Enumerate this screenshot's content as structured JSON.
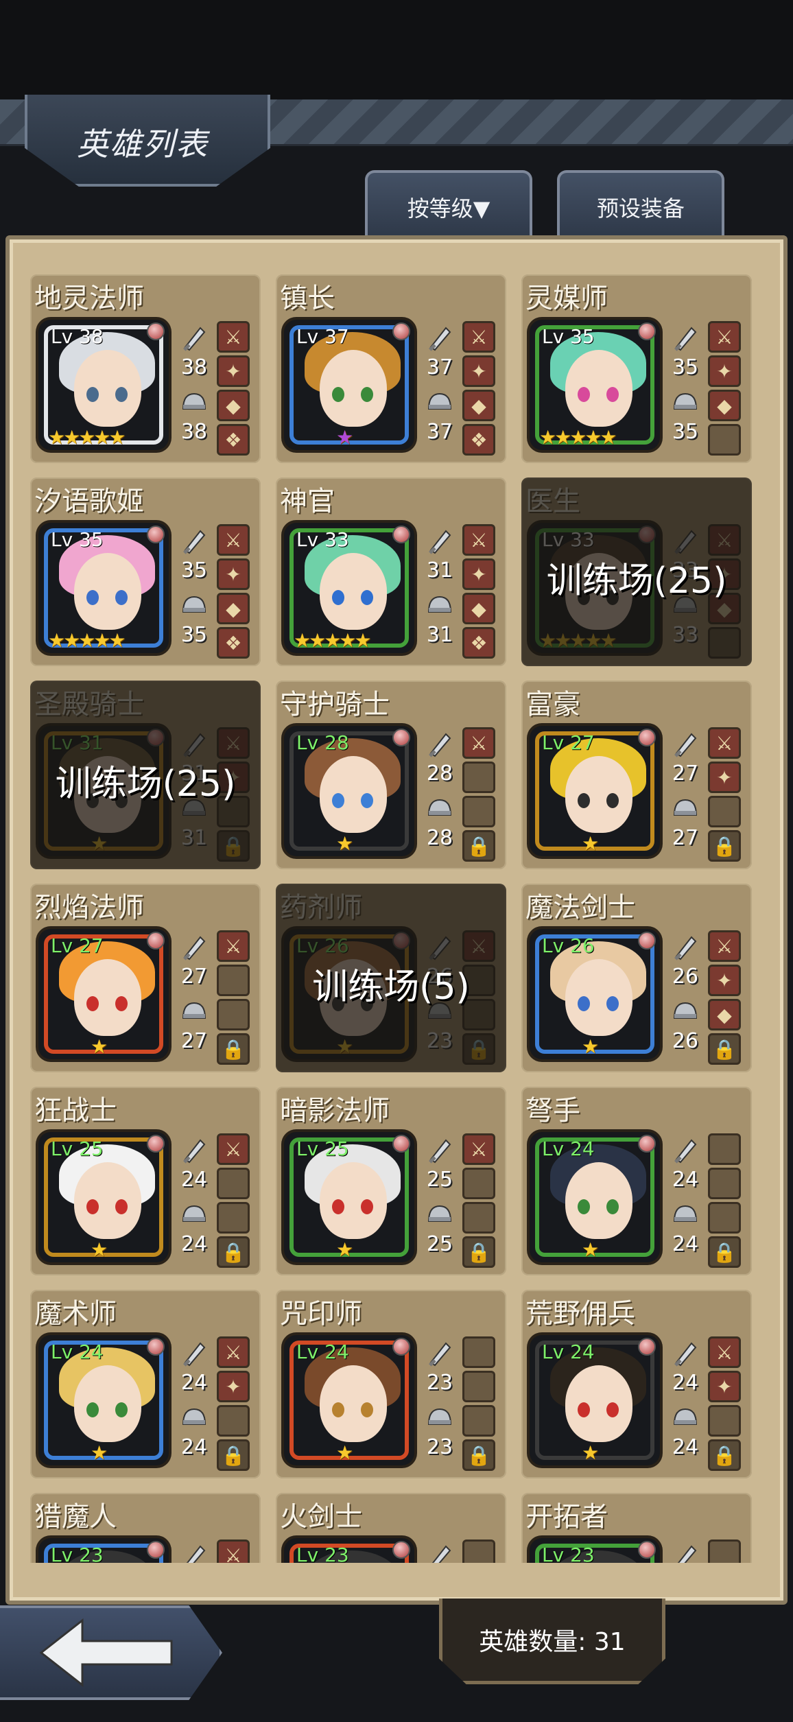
{
  "header": {
    "title": "英雄列表",
    "sort_button": "按等级▼",
    "preset_button": "预设装备"
  },
  "footer": {
    "hero_count": "英雄数量: 31"
  },
  "heroes": [
    {
      "name": "地灵法师",
      "level": "Lv 38",
      "atk": "38",
      "def": "38",
      "stars": 5,
      "color": "#e3e6ea",
      "hair": "#d9dde2",
      "eye": "#4a6b8d",
      "equip": [
        1,
        1,
        1,
        1
      ],
      "locked": false,
      "training": ""
    },
    {
      "name": "镇长",
      "level": "Lv 37",
      "atk": "37",
      "def": "37",
      "stars": 1,
      "color": "#3d7fd6",
      "hair": "#c7892f",
      "eye": "#3a8a3a",
      "equip": [
        1,
        1,
        1,
        1
      ],
      "locked": false,
      "training": ""
    },
    {
      "name": "灵媒师",
      "level": "Lv 35",
      "atk": "35",
      "def": "35",
      "stars": 5,
      "color": "#44a13a",
      "hair": "#6ad1b3",
      "eye": "#d84a9b",
      "equip": [
        1,
        1,
        1,
        0
      ],
      "locked": false,
      "training": ""
    },
    {
      "name": "汐语歌姬",
      "level": "Lv 35",
      "atk": "35",
      "def": "35",
      "stars": 5,
      "color": "#3d7fd6",
      "hair": "#f0a6cf",
      "eye": "#3c6fc9",
      "equip": [
        1,
        1,
        1,
        1
      ],
      "locked": false,
      "training": ""
    },
    {
      "name": "神官",
      "level": "Lv 33",
      "atk": "31",
      "def": "31",
      "stars": 5,
      "color": "#44a13a",
      "hair": "#6fd1a8",
      "eye": "#2f6fd0",
      "equip": [
        1,
        1,
        1,
        1
      ],
      "locked": false,
      "training": ""
    },
    {
      "name": "医生",
      "level": "Lv 33",
      "atk": "33",
      "def": "33",
      "stars": 5,
      "color": "#44a13a",
      "hair": "#4b3b2c",
      "eye": "#2d2d2d",
      "equip": [
        1,
        1,
        1,
        0
      ],
      "locked": false,
      "training": "训练场(25)"
    },
    {
      "name": "圣殿骑士",
      "level": "Lv 31",
      "atk": "31",
      "def": "31",
      "stars": 1,
      "color": "#c08a1e",
      "hair": "#6e5a3c",
      "eye": "#3a3a3a",
      "equip": [
        1,
        1,
        0,
        0
      ],
      "locked": true,
      "training": "训练场(25)"
    },
    {
      "name": "守护骑士",
      "level": "Lv 28",
      "atk": "28",
      "def": "28",
      "stars": 1,
      "color": "#3a3a3a",
      "hair": "#8c5a38",
      "eye": "#3d7fd6",
      "equip": [
        1,
        0,
        0,
        0
      ],
      "locked": true,
      "training": ""
    },
    {
      "name": "富豪",
      "level": "Lv 27",
      "atk": "27",
      "def": "27",
      "stars": 1,
      "color": "#c08a1e",
      "hair": "#e7c22b",
      "eye": "#2d2d2d",
      "equip": [
        1,
        1,
        0,
        0
      ],
      "locked": true,
      "training": ""
    },
    {
      "name": "烈焰法师",
      "level": "Lv 27",
      "atk": "27",
      "def": "27",
      "stars": 1,
      "color": "#d24a25",
      "hair": "#f29a33",
      "eye": "#c9302c",
      "equip": [
        1,
        0,
        0,
        0
      ],
      "locked": true,
      "training": ""
    },
    {
      "name": "药剂师",
      "level": "Lv 26",
      "atk": "26",
      "def": "23",
      "stars": 1,
      "color": "#c08a1e",
      "hair": "#a56d3d",
      "eye": "#3a3a3a",
      "equip": [
        1,
        0,
        0,
        0
      ],
      "locked": true,
      "training": "训练场(5)"
    },
    {
      "name": "魔法剑士",
      "level": "Lv 26",
      "atk": "26",
      "def": "26",
      "stars": 1,
      "color": "#3d7fd6",
      "hair": "#e8c9a2",
      "eye": "#3c6fc9",
      "equip": [
        1,
        1,
        1,
        0
      ],
      "locked": true,
      "training": ""
    },
    {
      "name": "狂战士",
      "level": "Lv 25",
      "atk": "24",
      "def": "24",
      "stars": 1,
      "color": "#c08a1e",
      "hair": "#f2f2f2",
      "eye": "#c9302c",
      "equip": [
        1,
        0,
        0,
        0
      ],
      "locked": true,
      "training": ""
    },
    {
      "name": "暗影法师",
      "level": "Lv 25",
      "atk": "25",
      "def": "25",
      "stars": 1,
      "color": "#44a13a",
      "hair": "#e6e6e6",
      "eye": "#c9302c",
      "equip": [
        1,
        0,
        0,
        0
      ],
      "locked": true,
      "training": ""
    },
    {
      "name": "弩手",
      "level": "Lv 24",
      "atk": "24",
      "def": "24",
      "stars": 1,
      "color": "#44a13a",
      "hair": "#2a3346",
      "eye": "#3a8a3a",
      "equip": [
        0,
        0,
        0,
        0
      ],
      "locked": true,
      "training": ""
    },
    {
      "name": "魔术师",
      "level": "Lv 24",
      "atk": "24",
      "def": "24",
      "stars": 1,
      "color": "#3d7fd6",
      "hair": "#e7c463",
      "eye": "#3a8a3a",
      "equip": [
        1,
        1,
        0,
        0
      ],
      "locked": true,
      "training": ""
    },
    {
      "name": "咒印师",
      "level": "Lv 24",
      "atk": "23",
      "def": "23",
      "stars": 1,
      "color": "#d24a25",
      "hair": "#7a4a2b",
      "eye": "#b7812f",
      "equip": [
        0,
        0,
        0,
        0
      ],
      "locked": true,
      "training": ""
    },
    {
      "name": "荒野佣兵",
      "level": "Lv 24",
      "atk": "24",
      "def": "24",
      "stars": 1,
      "color": "#3a3a3a",
      "hair": "#2b241c",
      "eye": "#c9302c",
      "equip": [
        1,
        1,
        0,
        0
      ],
      "locked": true,
      "training": ""
    },
    {
      "name": "猎魔人",
      "level": "Lv 23",
      "atk": "",
      "def": "",
      "stars": 0,
      "color": "#3d7fd6",
      "hair": "#333",
      "eye": "#333",
      "equip": [
        1,
        0,
        0,
        0
      ],
      "locked": true,
      "training": ""
    },
    {
      "name": "火剑士",
      "level": "Lv 23",
      "atk": "",
      "def": "",
      "stars": 0,
      "color": "#d24a25",
      "hair": "#333",
      "eye": "#333",
      "equip": [
        0,
        0,
        0,
        0
      ],
      "locked": true,
      "training": ""
    },
    {
      "name": "开拓者",
      "level": "Lv 23",
      "atk": "",
      "def": "",
      "stars": 0,
      "color": "#44a13a",
      "hair": "#333",
      "eye": "#333",
      "equip": [
        0,
        0,
        0,
        0
      ],
      "locked": true,
      "training": ""
    }
  ]
}
